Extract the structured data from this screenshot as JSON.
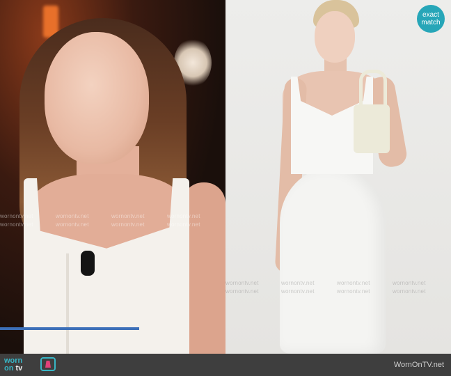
{
  "badge": {
    "line1": "exact",
    "line2": "match",
    "color": "#27a6b8"
  },
  "watermark": {
    "text": "wornontv.net"
  },
  "footer": {
    "logo_word": "worn",
    "logo_on": "on",
    "logo_tv": "tv",
    "site": "WornOnTV.net",
    "accent": "#38b6c6"
  },
  "icons": [
    "dress-icon"
  ]
}
